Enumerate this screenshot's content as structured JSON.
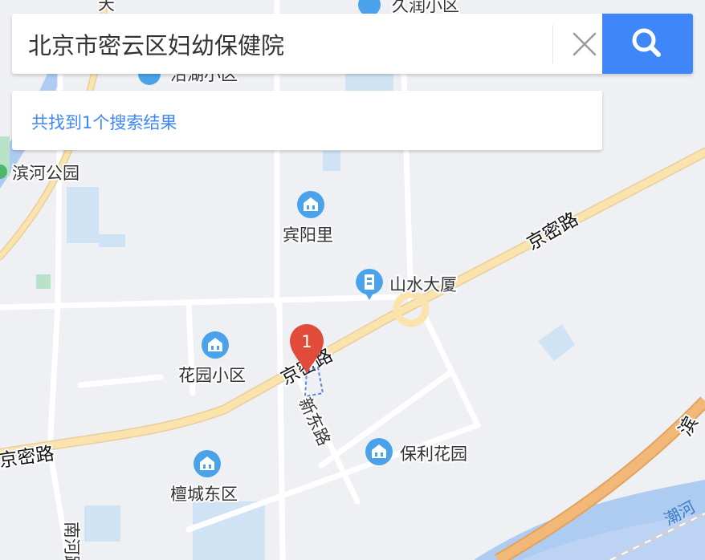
{
  "search": {
    "query": "北京市密云区妇幼保健院",
    "clear_icon": "close-icon",
    "search_icon": "search-icon"
  },
  "results": {
    "summary": "共找到1个搜索结果"
  },
  "map": {
    "colors": {
      "background": "#eef0f4",
      "water": "#aecbf2",
      "main_road": "#fbe3ad",
      "highway": "#f1b877",
      "poi_icon": "#4aa3ea",
      "marker": "#e04b3a",
      "accent": "#3f86f9"
    },
    "pois": [
      {
        "name": "滨河公园",
        "icon": "park-icon"
      },
      {
        "name": "宾阳里",
        "icon": "residential-icon"
      },
      {
        "name": "山水大厦",
        "icon": "building-icon"
      },
      {
        "name": "花园小区",
        "icon": "residential-icon"
      },
      {
        "name": "保利花园",
        "icon": "residential-icon"
      },
      {
        "name": "檀城东区",
        "icon": "residential-icon"
      }
    ],
    "partial_labels": [
      "久润小区",
      "沿湖小区",
      "天"
    ],
    "roads": {
      "jingmi_upper": "京密路",
      "jingmi_lower": "京密路",
      "jingmi_marker": "京密路",
      "xindong": "新东路",
      "nanhe": "南河路",
      "edge": "滨"
    },
    "river": "潮河",
    "marker": {
      "label": "1",
      "icon": "map-pin-icon"
    }
  }
}
